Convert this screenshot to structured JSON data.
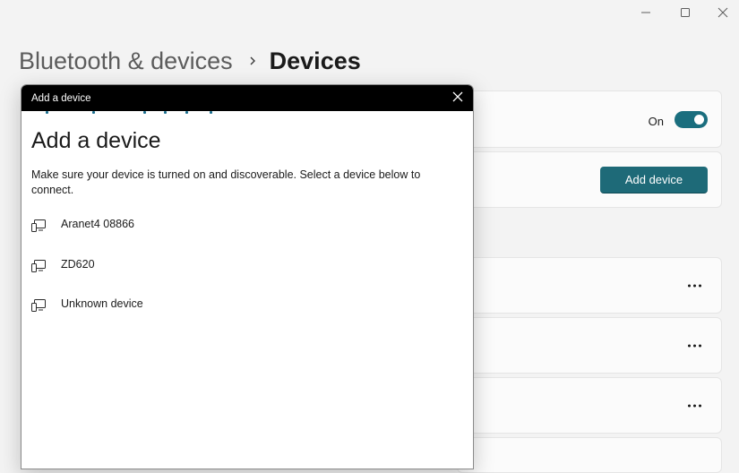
{
  "window": {
    "controls": {
      "minimize_icon": "minimize-icon",
      "maximize_icon": "maximize-icon",
      "close_icon": "close-icon"
    }
  },
  "breadcrumb": {
    "parent": "Bluetooth & devices",
    "separator_icon": "chevron-right-icon",
    "current": "Devices"
  },
  "cards": {
    "bluetooth_toggle": {
      "state_label": "On",
      "on": true
    },
    "add_device": {
      "button_label": "Add device"
    },
    "device_rows": [
      {
        "more_icon": "more-options-icon"
      },
      {
        "more_icon": "more-options-icon"
      },
      {
        "more_icon": "more-options-icon"
      }
    ]
  },
  "dialog": {
    "title_bar": "Add a device",
    "heading": "Add a device",
    "description": "Make sure your device is turned on and discoverable. Select a device below to connect.",
    "devices": [
      {
        "name": "Aranet4 08866",
        "icon": "device-icon"
      },
      {
        "name": "ZD620",
        "icon": "device-icon"
      },
      {
        "name": "Unknown device",
        "icon": "device-icon"
      }
    ]
  },
  "colors": {
    "accent": "#1e6a78",
    "toggle_on": "#1a6e7e",
    "titlebar": "#000000",
    "background": "#f3f3f3"
  }
}
